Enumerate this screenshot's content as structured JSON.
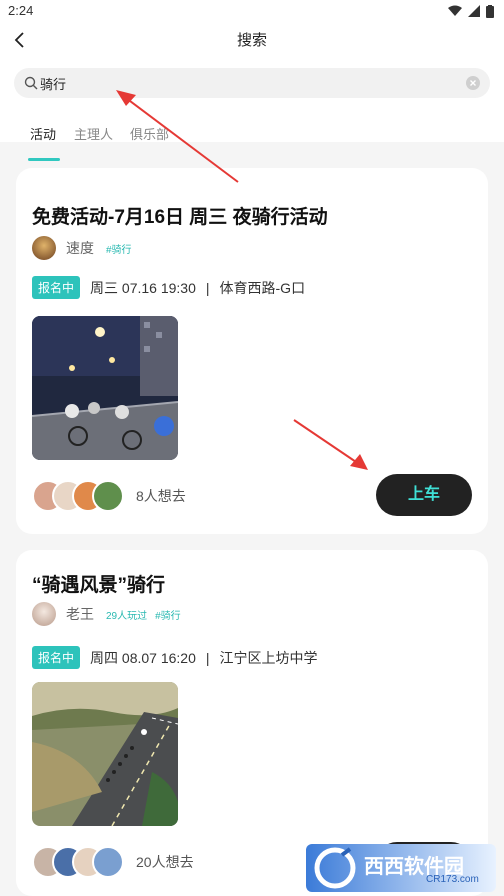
{
  "status_bar": {
    "time": "2:24"
  },
  "header": {
    "title": "搜索"
  },
  "search": {
    "query": "骑行"
  },
  "tabs": [
    {
      "label": "活动",
      "active": true
    },
    {
      "label": "主理人",
      "active": false
    },
    {
      "label": "俱乐部",
      "active": false
    }
  ],
  "cards": [
    {
      "title": "免费活动-7月16日 周三 夜骑行活动",
      "author": "速度",
      "tags": [
        "#骑行"
      ],
      "status": "报名中",
      "datetime": "周三 07.16 19:30",
      "separator": "|",
      "location": "体育西路-G口",
      "interested": "8人想去",
      "action": "上车"
    },
    {
      "title": "“骑遇风景”骑行",
      "author": "老王",
      "tags": [
        "29人玩过",
        "#骑行"
      ],
      "status": "报名中",
      "datetime": "周四 08.07 16:20",
      "separator": "|",
      "location": "江宁区上坊中学",
      "interested": "20人想去",
      "action": "上车"
    }
  ],
  "watermark": {
    "brand": "西西软件园",
    "domain": "CR173.com"
  },
  "colors": {
    "accent": "#2dc3bb",
    "button_bg": "#222222",
    "button_text": "#3fe0d6",
    "annotation": "#e53935"
  }
}
